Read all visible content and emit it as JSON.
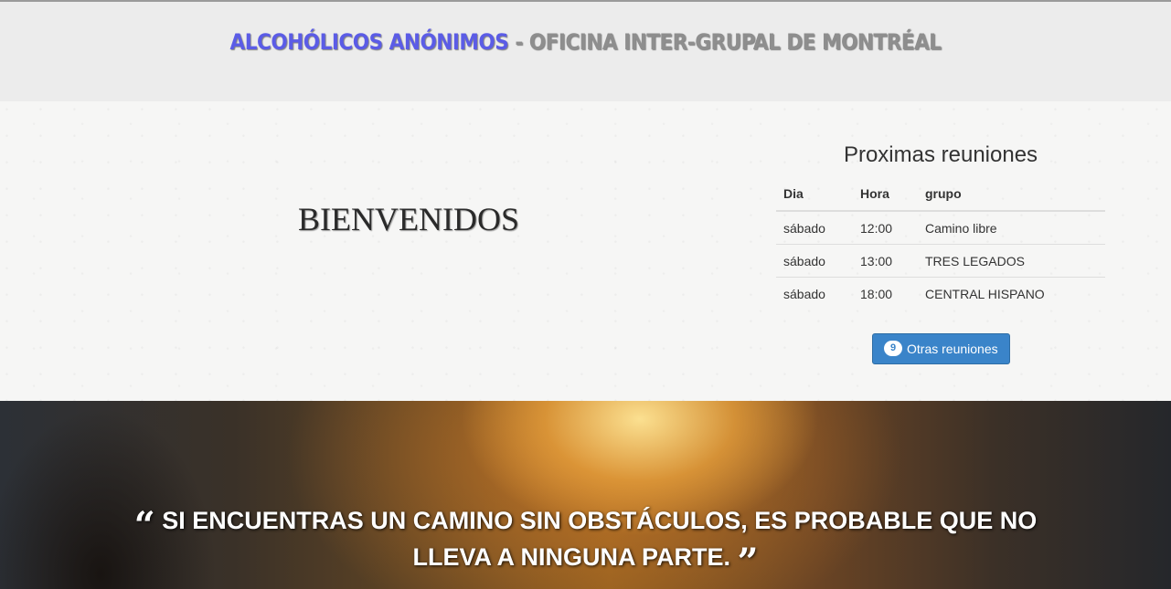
{
  "header": {
    "brand": "ALCOHÓLICOS ANÓNIMOS",
    "rest": " - OFICINA INTER-GRUPAL DE MONTRÉAL"
  },
  "welcome": "BIENVENIDOS",
  "meetings": {
    "title": "Proximas reuniones",
    "columns": [
      "Dia",
      "Hora",
      "grupo"
    ],
    "rows": [
      [
        "sábado",
        "12:00",
        "Camino libre"
      ],
      [
        "sábado",
        "13:00",
        "TRES LEGADOS"
      ],
      [
        "sábado",
        "18:00",
        "CENTRAL HISPANO"
      ]
    ],
    "more_count": "9",
    "more_label": "Otras reuniones"
  },
  "quote": {
    "line1": "SI ENCUENTRAS UN CAMINO SIN OBSTÁCULOS, ES PROBABLE QUE NO",
    "line2": "LLEVA A NINGUNA PARTE.",
    "open_icon": "quote-left-icon",
    "close_icon": "quote-right-icon"
  },
  "colors": {
    "brand": "#5b5ce6",
    "button": "#3a84c9"
  }
}
